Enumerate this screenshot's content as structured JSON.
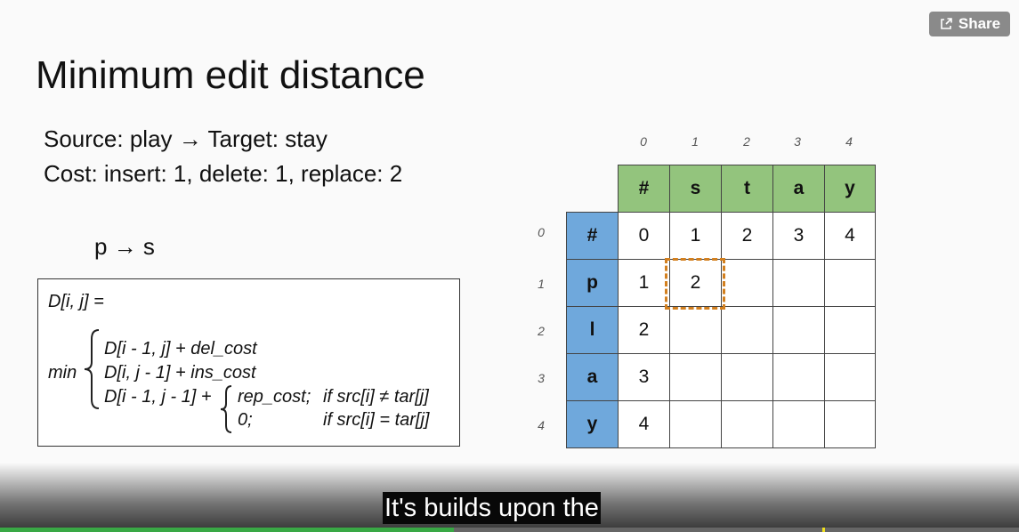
{
  "share": {
    "label": "Share",
    "icon": "share-icon"
  },
  "slide": {
    "title": "Minimum edit distance",
    "line1": "Source: play → Target: stay",
    "line2": "Cost: insert: 1,  delete: 1, replace: 2",
    "example": "p → s"
  },
  "formula": {
    "head": "D[i, j] =",
    "min": "min",
    "row1": "D[i - 1, j] + del_cost",
    "row2": "D[i, j - 1] + ins_cost",
    "row3": "D[i - 1, j - 1] +",
    "case1_a": "rep_cost;",
    "case1_b": "if src[i] ≠ tar[j]",
    "case2_a": "0;",
    "case2_b": "if src[i] = tar[j]"
  },
  "grid": {
    "col_indices": [
      "0",
      "1",
      "2",
      "3",
      "4"
    ],
    "row_indices": [
      "0",
      "1",
      "2",
      "3",
      "4"
    ],
    "target_header": [
      "#",
      "s",
      "t",
      "a",
      "y"
    ],
    "source_header": [
      "#",
      "p",
      "l",
      "a",
      "y"
    ],
    "cells": [
      [
        "0",
        "1",
        "2",
        "3",
        "4"
      ],
      [
        "1",
        "2",
        "",
        "",
        ""
      ],
      [
        "2",
        "",
        "",
        "",
        ""
      ],
      [
        "3",
        "",
        "",
        "",
        ""
      ],
      [
        "4",
        "",
        "",
        "",
        ""
      ]
    ],
    "highlight_color": "#d3801f",
    "target_color": "#93c47d",
    "source_color": "#6fa8dc"
  },
  "player": {
    "caption": "It's builds upon the",
    "progress_played": 0.445,
    "played_color": "#39a845"
  }
}
